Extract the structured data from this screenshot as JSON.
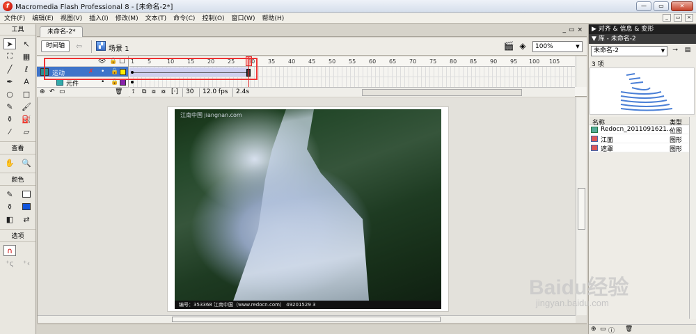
{
  "window": {
    "title": "Macromedia Flash Professional 8 - [未命名-2*]",
    "app_icon": "f",
    "controls": [
      "—",
      "▭",
      "✕"
    ]
  },
  "menu": [
    "文件(F)",
    "编辑(E)",
    "视图(V)",
    "插入(I)",
    "修改(M)",
    "文本(T)",
    "命令(C)",
    "控制(O)",
    "窗口(W)",
    "帮助(H)"
  ],
  "tools": {
    "header": "工具",
    "view_label": "查看",
    "color_label": "颜色",
    "options_label": "选项",
    "items": [
      "arrow-tool",
      "subselect-tool",
      "free-transform-tool",
      "fill-transform-tool",
      "line-tool",
      "lasso-tool",
      "pen-tool",
      "text-tool",
      "oval-tool",
      "rectangle-tool",
      "pencil-tool",
      "brush-tool",
      "ink-bottle-tool",
      "paint-bucket-tool",
      "eyedropper-tool",
      "eraser-tool"
    ],
    "view_items": [
      "hand-tool",
      "zoom-tool"
    ],
    "stroke_color": "#000000",
    "fill_color": "#1155dd"
  },
  "document": {
    "tab_label": "未命名-2*",
    "timeline_button": "时间轴",
    "scene_label": "场景 1",
    "zoom": "100%",
    "doc_ctrls": [
      "_",
      "▭",
      "×"
    ]
  },
  "timeline": {
    "header_icons": [
      "👁",
      "🔒",
      "□"
    ],
    "layers": [
      {
        "name": "运动",
        "active": true,
        "color": "#ffee00"
      },
      {
        "name": "元件",
        "active": false,
        "color": "#8822aa"
      }
    ],
    "ruler": [
      "1",
      "5",
      "10",
      "15",
      "20",
      "25",
      "30",
      "35",
      "40",
      "45",
      "50",
      "55",
      "60",
      "65",
      "70",
      "75",
      "80",
      "85",
      "90",
      "95",
      "100",
      "105"
    ],
    "current_frame": "30",
    "fps": "12.0 fps",
    "elapsed": "2.4s"
  },
  "stage": {
    "photo_watermark": "江南中国  jiangnan.com",
    "photo_caption": "编号：353368    江南中国（www.redocn.com）  49201529 3"
  },
  "library": {
    "align_header": "▶ 对齐 & 信息 & 变形",
    "lib_header": "▼ 库 - 未命名-2",
    "selected_doc": "未命名-2",
    "item_count": "3 项",
    "col_name": "名称",
    "col_type": "类型",
    "items": [
      {
        "name": "Redocn_2011091621...",
        "type": "位图",
        "icon": "bitmap-icon"
      },
      {
        "name": "江面",
        "type": "图形",
        "icon": "graphic-icon"
      },
      {
        "name": "遮罩",
        "type": "图形",
        "icon": "graphic-icon"
      }
    ]
  },
  "watermark": {
    "brand": "Baidu经验",
    "url": "jingyan.baidu.com"
  }
}
